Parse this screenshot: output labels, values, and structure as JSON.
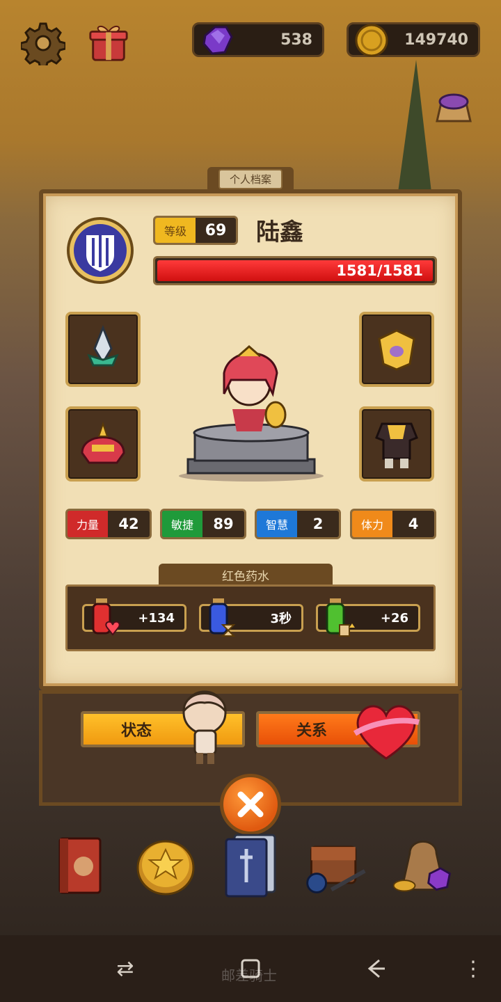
{
  "top": {
    "gems": "538",
    "coins": "149740"
  },
  "profile": {
    "tab_label": "个人档案",
    "level_label": "等级",
    "level_value": "69",
    "name": "陆鑫",
    "hp_text": "1581/1581",
    "hp_fraction": 1.0
  },
  "stats": [
    {
      "label": "力量",
      "value": "42",
      "color": "#d02a2a"
    },
    {
      "label": "敏捷",
      "value": "89",
      "color": "#1f9a3a"
    },
    {
      "label": "智慧",
      "value": "2",
      "color": "#1e78d8"
    },
    {
      "label": "体力",
      "value": "4",
      "color": "#f08a1a"
    }
  ],
  "potion": {
    "title": "红色药水",
    "items": [
      {
        "value": "+134",
        "icon": "heart-potion-icon"
      },
      {
        "value": "3秒",
        "icon": "hourglass-potion-icon"
      },
      {
        "value": "+26",
        "icon": "scroll-potion-icon"
      }
    ]
  },
  "buttons": {
    "status": "状态",
    "relation": "关系"
  },
  "bottom_nav": [
    "book-icon",
    "star-coin-icon",
    "cards-icon",
    "bag-icon",
    "treasure-sack-icon"
  ],
  "system_ghost_text": "邮差骑士"
}
